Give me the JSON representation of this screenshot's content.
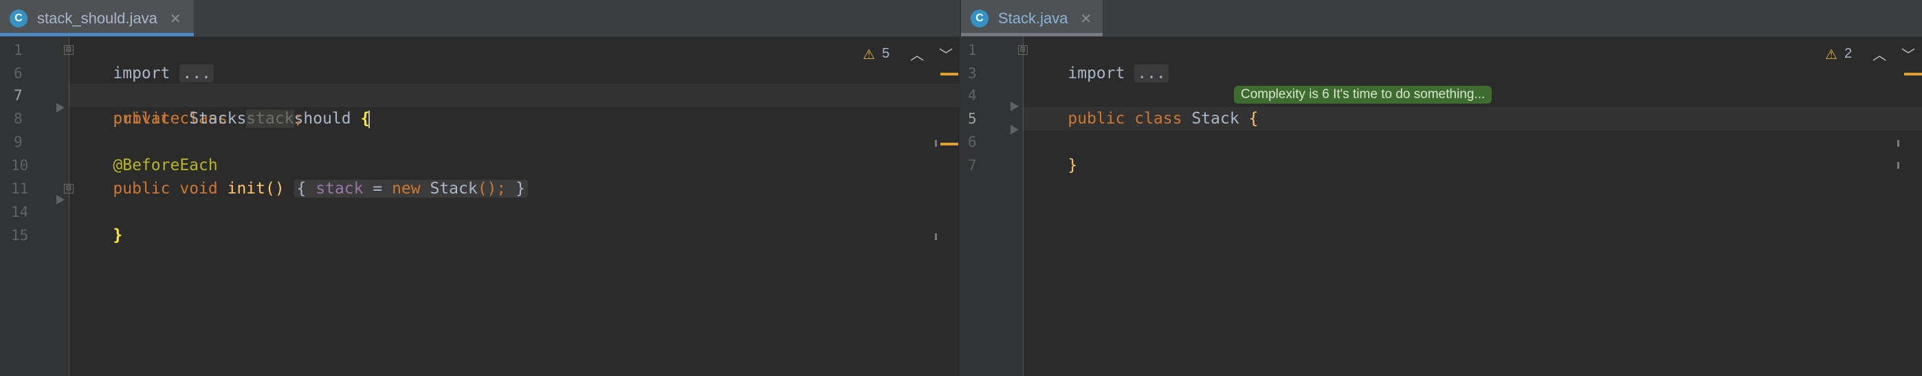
{
  "left_pane": {
    "tab": {
      "label": "stack_should.java",
      "icon_letter": "C",
      "icon": "class-icon"
    },
    "warnings": {
      "count": "5"
    },
    "line_numbers": [
      "1",
      "6",
      "7",
      "8",
      "9",
      "10",
      "11",
      "14",
      "15"
    ],
    "code": {
      "l1_import": "import",
      "l1_fold": "...",
      "l7_public": "public",
      "l7_class": "class",
      "l7_name": "stack_should",
      "l7_brace": "{",
      "l8_private": "private",
      "l8_type": "Stack",
      "l8_field": "stack",
      "l8_semi": ";",
      "l10_annotation": "@BeforeEach",
      "l11_public": "public",
      "l11_void": "void",
      "l11_method": "init",
      "l11_parens": "()",
      "l11_open": "{",
      "l11_field": "stack",
      "l11_eq": " = ",
      "l11_new": "new",
      "l11_ctor": "Stack",
      "l11_call": "();",
      "l11_close": "}",
      "l14_brace": "}"
    }
  },
  "right_pane": {
    "tab": {
      "label": "Stack.java",
      "icon_letter": "C",
      "icon": "class-icon"
    },
    "warnings": {
      "count": "2"
    },
    "line_numbers": [
      "1",
      "3",
      "4",
      "5",
      "6",
      "7"
    ],
    "code": {
      "l1_import": "import",
      "l1_fold": "...",
      "l4_public": "public",
      "l4_class": "class",
      "l4_name": "Stack",
      "l4_brace": "{",
      "l6_brace": "}"
    },
    "inlay_hint": "Complexity is 6 It's time to do something..."
  },
  "icons": {
    "warning": "warning-triangle-icon",
    "prev": "chevron-up-icon",
    "next": "chevron-down-icon",
    "close": "close-icon"
  },
  "colors": {
    "editor_bg": "#2b2b2b",
    "tab_active_underline": "#4a88c7",
    "keyword": "#cc7832",
    "method": "#ffc66d",
    "annotation": "#bbb529",
    "field": "#9876aa",
    "inlay_bg": "#3d6b30",
    "warning": "#e5b53a"
  }
}
